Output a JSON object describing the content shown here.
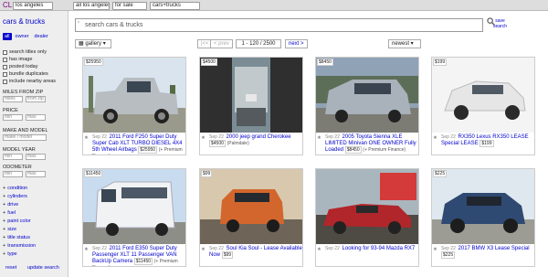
{
  "top": {
    "logo": "CL",
    "location": "los angeles",
    "area": "all los angeles",
    "section": "for sale",
    "category": "cars+trucks"
  },
  "sidebar": {
    "title": "cars & trucks",
    "tabs": [
      "all",
      "owner",
      "dealer"
    ],
    "checks": [
      "search titles only",
      "has image",
      "posted today",
      "bundle duplicates",
      "include nearby areas"
    ],
    "miles_label": "MILES FROM ZIP",
    "miles_placeholder": "miles",
    "zip_placeholder": "from zip",
    "price_label": "PRICE",
    "min_placeholder": "min",
    "max_placeholder": "max",
    "make_label": "MAKE AND MODEL",
    "make_placeholder": "make / model",
    "year_label": "MODEL YEAR",
    "odo_label": "ODOMETER",
    "filters": [
      "condition",
      "cylinders",
      "drive",
      "fuel",
      "paint color",
      "size",
      "title status",
      "transmission",
      "type"
    ],
    "reset": "reset",
    "update": "update search"
  },
  "search": {
    "placeholder": "search cars & trucks",
    "save": "save",
    "search_label": "search"
  },
  "toolbar": {
    "view": "gallery",
    "first": "|<<",
    "prev": "< prev",
    "range": "1 - 120 / 2500",
    "next": "next >",
    "sort": "newest"
  },
  "listings": [
    {
      "price": "$25950",
      "date": "Sep 22",
      "title": "2011 Ford F250 Super Duty Super Cab XLT TURBO DIESEL 4X4 5th Wheel Airbags",
      "tag": "$25950",
      "hood": "(+ Premium Finance)"
    },
    {
      "price": "$4500",
      "date": "Sep 22",
      "title": "2000 jeep grand Cherokee",
      "tag": "$4500",
      "hood": "(Palmdale)"
    },
    {
      "price": "$8450",
      "date": "Sep 22",
      "title": "2005 Toyota Sienna XLE LIMITED Minivan ONE OWNER Fully Loaded",
      "tag": "$8450",
      "hood": "(+ Premium Finance)"
    },
    {
      "price": "$199",
      "date": "Sep 22",
      "title": "RX350 Lexus RX350 LEASE Special LEASE",
      "tag": "$199",
      "hood": ""
    },
    {
      "price": "$11450",
      "date": "Sep 22",
      "title": "2011 Ford E350 Super Duty Passenger XLT 11 Passenger VAN BackUp Camera",
      "tag": "$11450",
      "hood": "(+ Premium Finance)"
    },
    {
      "price": "$99",
      "date": "Sep 22",
      "title": "Soul Kia Soul - Lease Available Now",
      "tag": "$99",
      "hood": ""
    },
    {
      "price": "",
      "date": "Sep 22",
      "title": "Looking for 93-94 Mazda RX7",
      "tag": "",
      "hood": ""
    },
    {
      "price": "$225",
      "date": "Sep 22",
      "title": "2017 BMW X3 Lease Special",
      "tag": "$225",
      "hood": ""
    }
  ],
  "colors": {
    "link": "#0000cc",
    "sidebar": "#eeeeee"
  }
}
